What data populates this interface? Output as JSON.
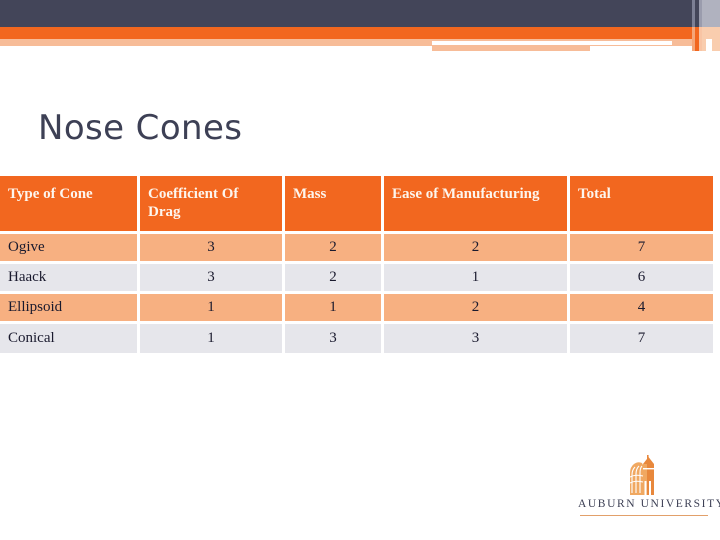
{
  "slide": {
    "title": "Nose Cones"
  },
  "theme": {
    "dark_navy": "#434559",
    "orange": "#F2671F",
    "light_orange_row": "#F7B081",
    "light_gray_row": "#E6E6EB",
    "peach": "#F7BC98",
    "header_text": "#FDF6EE"
  },
  "table": {
    "columns": [
      "Type of Cone",
      "Coefficient Of Drag",
      "Mass",
      "Ease of Manufacturing",
      "Total"
    ],
    "rows": [
      {
        "type": "Ogive",
        "drag": "3",
        "mass": "2",
        "ease": "2",
        "total": "7"
      },
      {
        "type": "Haack",
        "drag": "3",
        "mass": "2",
        "ease": "1",
        "total": "6"
      },
      {
        "type": "Ellipsoid",
        "drag": "1",
        "mass": "1",
        "ease": "2",
        "total": "4"
      },
      {
        "type": "Conical",
        "drag": "1",
        "mass": "3",
        "ease": "3",
        "total": "7"
      }
    ]
  },
  "logo": {
    "name": "AUBURN UNIVERSITY",
    "mark": "auburn-tower-icon"
  }
}
